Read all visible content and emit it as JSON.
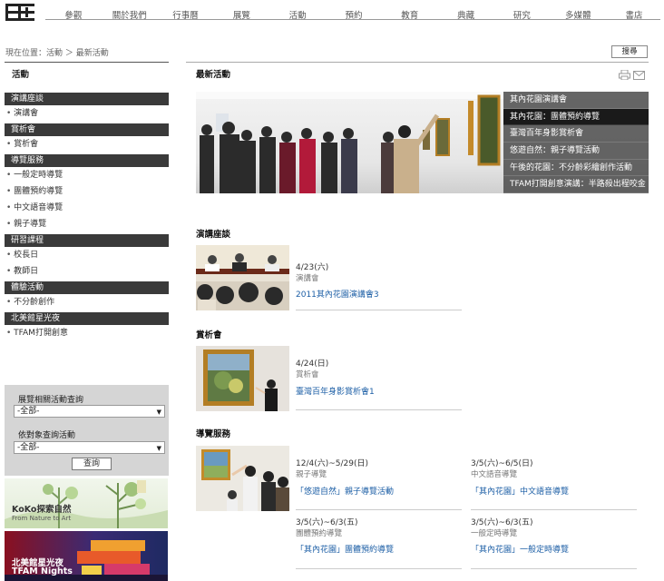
{
  "nav": [
    "參觀",
    "關於我們",
    "行事曆",
    "展覽",
    "活動",
    "預約",
    "教育",
    "典藏",
    "研究",
    "多媒體",
    "書店"
  ],
  "nav_active_index": 4,
  "breadcrumb": "現在位置：活動 ＞ 最新活動",
  "search_label": "搜尋",
  "sidebar": {
    "title": "活動",
    "groups": [
      {
        "label": "演講座談",
        "items": [
          "演講會"
        ]
      },
      {
        "label": "賞析會",
        "items": [
          "賞析會"
        ]
      },
      {
        "label": "導覽服務",
        "items": [
          "一般定時導覽",
          "團體預約導覽",
          "中文語音導覽",
          "親子導覽"
        ]
      },
      {
        "label": "研習課程",
        "items": [
          "校長日",
          "教師日"
        ]
      },
      {
        "label": "體驗活動",
        "items": [
          "不分齡創作"
        ]
      },
      {
        "label": "北美館星光夜",
        "items": [
          "TFAM打開創意"
        ]
      }
    ]
  },
  "query": {
    "label1": "展覽相關活動查詢",
    "select1": "-全部-",
    "label2": "依對象查詢活動",
    "select2": "-全部-",
    "button": "查詢"
  },
  "banners": [
    {
      "title": "KoKo探索自然",
      "subtitle": "From Nature to Art"
    },
    {
      "title": "北美館星光夜",
      "subtitle": "TFAM Nights"
    }
  ],
  "main": {
    "title": "最新活動",
    "hero_items": [
      "其內花園演講會",
      "其內花園：團體預約導覽",
      "臺灣百年身影賞析會",
      "悠遊自然：親子導覽活動",
      "午後的花園：不分齡彩繪創作活動",
      "TFAM打開創意演講：半路殺出程咬金"
    ],
    "hero_active_index": 1
  },
  "sections": [
    {
      "title": "演講座談",
      "events": [
        {
          "date": "4/23(六)",
          "type": "演講會",
          "title": "2011其內花園演講會3"
        }
      ]
    },
    {
      "title": "賞析會",
      "events": [
        {
          "date": "4/24(日)",
          "type": "賞析會",
          "title": "臺灣百年身影賞析會1"
        }
      ]
    },
    {
      "title": "導覽服務",
      "events": [
        {
          "date": "12/4(六)~5/29(日)",
          "type": "親子導覽",
          "title": "「悠遊自然」親子導覽活動"
        },
        {
          "date": "3/5(六)~6/5(日)",
          "type": "中文語音導覽",
          "title": "「其內花園」中文語音導覽"
        },
        {
          "date": "3/5(六)~6/3(五)",
          "type": "團體預約導覽",
          "title": "「其內花園」團體預約導覽"
        },
        {
          "date": "3/5(六)~6/3(五)",
          "type": "一般定時導覽",
          "title": "「其內花園」一般定時導覽"
        }
      ]
    }
  ],
  "icons": [
    "logo-icon",
    "print-icon",
    "mail-icon",
    "chevron-down-icon"
  ]
}
